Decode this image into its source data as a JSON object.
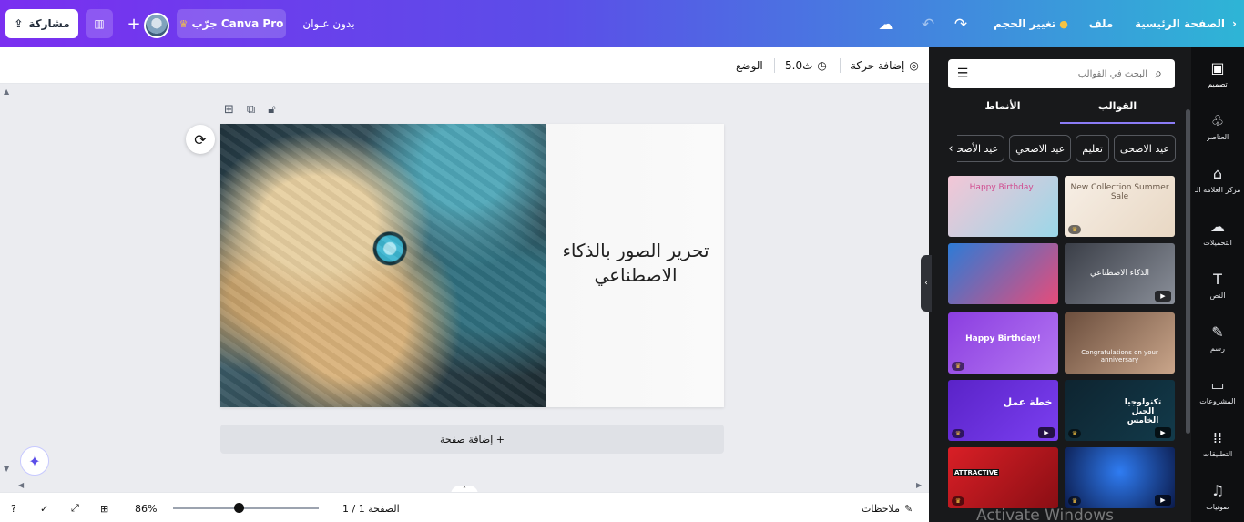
{
  "topbar": {
    "share_label": "مشاركة",
    "try_pro_label": "جرّب Canva Pro",
    "doc_title": "بدون عنوان",
    "resize_label": "تغيير الحجم",
    "file_label": "ملف",
    "home_label": "الصفحة الرئيسية"
  },
  "context_bar": {
    "add_animation": "إضافة حركة",
    "duration": "5.0ث",
    "position": "الوضع"
  },
  "design": {
    "heading": "تحرير الصور بالذكاء الاصطناعي"
  },
  "add_page_label": "+ إضافة صفحة",
  "bottom_bar": {
    "zoom": "86%",
    "page_indicator": "الصفحة 1 / 1",
    "notes": "ملاحظات",
    "zoom_level": 0.45
  },
  "side_panel": {
    "search_placeholder": "البحث في القوالب",
    "tabs": [
      "القوالب",
      "الأنماط"
    ],
    "chips": [
      "عيد الاضحى",
      "تعليم",
      "عيد الاضحي",
      "عيد الأضحى"
    ],
    "thumbs": [
      {
        "label": "Happy Birthday!",
        "bg": "linear-gradient(135deg,#f4c6d6,#9ad7e8)",
        "crown": false,
        "play": false
      },
      {
        "label": "New Collection Summer Sale",
        "bg": "linear-gradient(135deg,#f7efe6,#e8d7c3)",
        "crown": true,
        "play": false
      },
      {
        "label": "",
        "bg": "linear-gradient(135deg,#2d7bd6,#e64c7a)",
        "crown": false,
        "play": false
      },
      {
        "label": "الذكاء الاصطناعي",
        "bg": "linear-gradient(135deg,#3a3e47,#8a8f99)",
        "crown": false,
        "play": true
      },
      {
        "label": "Happy Birthday!",
        "bg": "linear-gradient(135deg,#8b3ee0,#b476f2)",
        "crown": true,
        "play": false
      },
      {
        "label": "Congratulations on your anniversary",
        "bg": "linear-gradient(135deg,#6b4e3d,#c9a58a)",
        "crown": false,
        "play": false
      },
      {
        "label": "خطة عمل",
        "bg": "linear-gradient(135deg,#5a23c8,#7b3ff0)",
        "crown": true,
        "play": true
      },
      {
        "label": "تكنولوجيا الجيل الخامس",
        "bg": "linear-gradient(135deg,#0e2430,#123a4a)",
        "crown": true,
        "play": true
      },
      {
        "label": "ATTRACTIVE",
        "bg": "linear-gradient(135deg,#d91f26,#8a0e14)",
        "crown": true,
        "play": false
      },
      {
        "label": "",
        "bg": "radial-gradient(circle at 50% 40%,#2f7cf2,#0b1a4a)",
        "crown": true,
        "play": true
      }
    ]
  },
  "rail": {
    "items": [
      "تصميم",
      "العناصر",
      "مركز العلامة الـ",
      "التحميلات",
      "النص",
      "رسم",
      "المشروعات",
      "التطبيقات",
      "صوتيات"
    ]
  },
  "watermark": "Activate Windows"
}
